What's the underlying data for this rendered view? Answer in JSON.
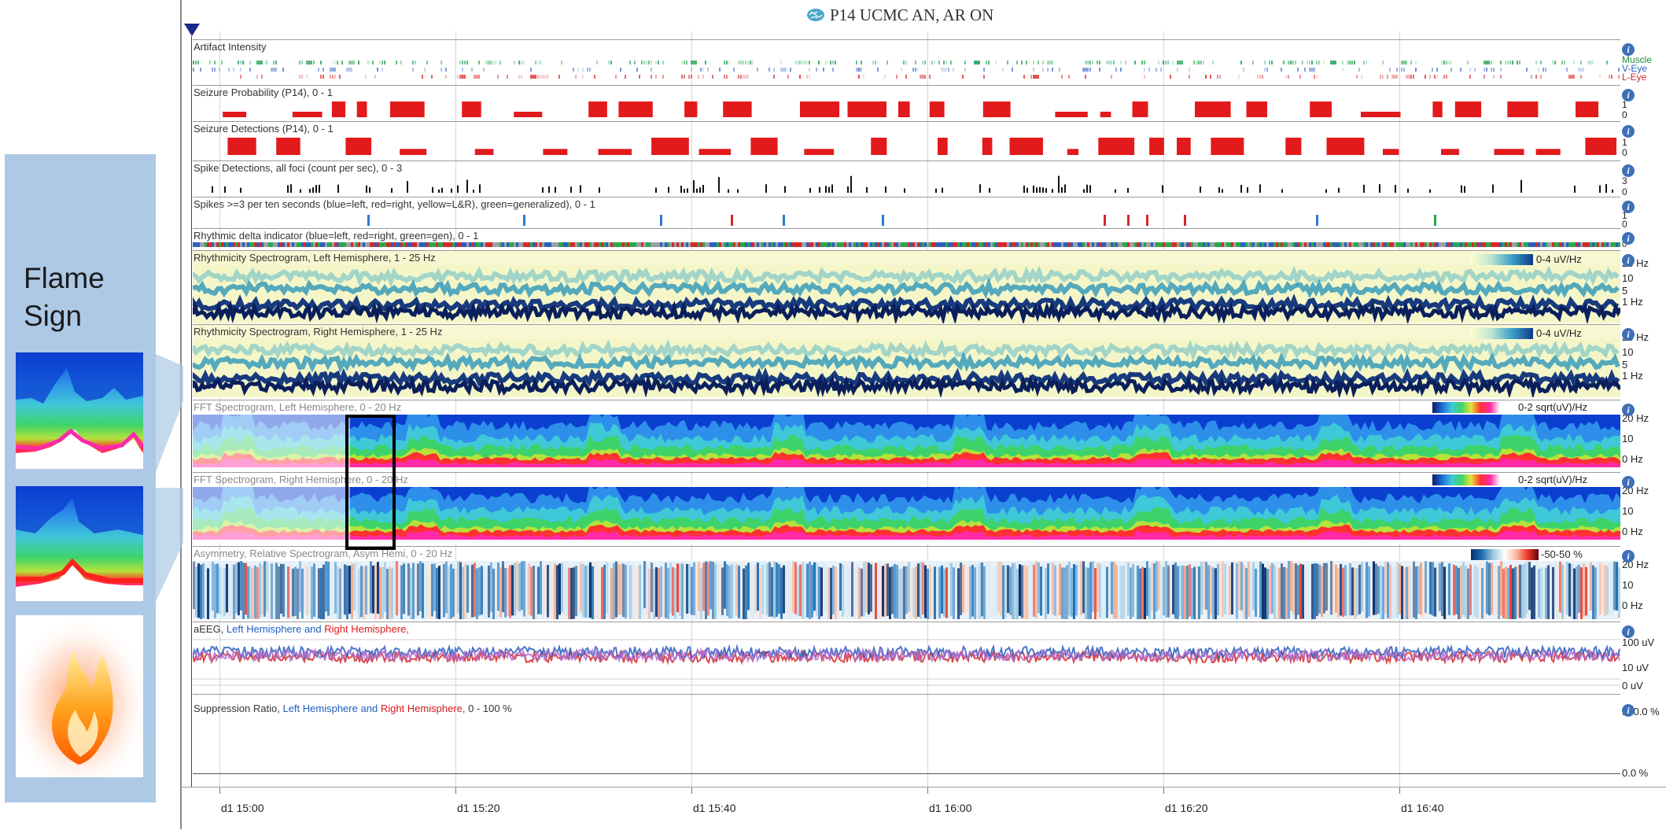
{
  "left_panel": {
    "title_line1": "Flame",
    "title_line2": "Sign",
    "thumbnails": [
      "fft-left-flame-thumbnail",
      "fft-right-flame-thumbnail",
      "flame-image"
    ],
    "color": "#adc9e6"
  },
  "window": {
    "title": "P14 UCMC AN, AR ON",
    "icon": "brain-icon"
  },
  "panels": {
    "artifact": {
      "label": "Artifact Intensity",
      "legend": [
        "Muscle",
        "V-Eye",
        "L-Eye"
      ],
      "legend_colors": [
        "#1a8f3c",
        "#2c5fbf",
        "#d62828"
      ]
    },
    "seizure_prob": {
      "label": "Seizure Probability (P14), 0 - 1",
      "ticks": [
        "1",
        "0"
      ],
      "color": "#e31a1c"
    },
    "seizure_det": {
      "label": "Seizure Detections (P14), 0 - 1",
      "ticks": [
        "1",
        "0"
      ],
      "color": "#e31a1c"
    },
    "spike_det": {
      "label": "Spike Detections, all foci (count per sec), 0 - 3",
      "ticks": [
        "3",
        "0"
      ]
    },
    "spikes_ten": {
      "label": "Spikes >=3 per ten seconds (blue=left, red=right, yellow=L&R), green=generalized),  0 - 1",
      "ticks": [
        "1",
        "0"
      ]
    },
    "rhythmic_delta": {
      "label": "Rhythmic delta indicator (blue=left, red=right, green=gen),  0 - 1",
      "ticks": [
        "1",
        "0"
      ]
    },
    "rhythm_left": {
      "label": "Rhythmicity Spectrogram, Left Hemisphere, 1 - 25 Hz",
      "scale_label": "0-4 uV/Hz",
      "ticks": [
        "25 Hz",
        "10",
        "5",
        "1 Hz"
      ]
    },
    "rhythm_right": {
      "label": "Rhythmicity Spectrogram, Right Hemisphere, 1 - 25 Hz",
      "scale_label": "0-4 uV/Hz",
      "ticks": [
        "25 Hz",
        "10",
        "5",
        "1 Hz"
      ]
    },
    "fft_left": {
      "label": "FFT Spectrogram, Left Hemisphere, 0 - 20 Hz",
      "scale_label": "0-2 sqrt(uV)/Hz",
      "ticks": [
        "20 Hz",
        "10",
        "0 Hz"
      ]
    },
    "fft_right": {
      "label": "FFT Spectrogram, Right Hemisphere, 0 - 20 Hz",
      "scale_label": "0-2 sqrt(uV)/Hz",
      "ticks": [
        "20 Hz",
        "10",
        "0 Hz"
      ]
    },
    "asym": {
      "label": "Asymmetry, Relative Spectrogram, Asym Hemi, 0 - 20 Hz",
      "scale_label": "-50-50 %",
      "ticks": [
        "20 Hz",
        "10",
        "0 Hz"
      ]
    },
    "aeeg": {
      "label_prefix": "aEEG,",
      "label_left": "Left Hemisphere",
      "label_and": "and",
      "label_right": "Right Hemisphere,",
      "ticks": [
        "100 uV",
        "10 uV",
        "0 uV"
      ]
    },
    "suppression": {
      "label_prefix": "Suppression Ratio,",
      "label_left": "Left Hemisphere",
      "label_and": "and",
      "label_right": "Right Hemisphere,",
      "label_range": "0 - 100 %",
      "ticks": [
        "100.0 %",
        "0.0 %"
      ]
    }
  },
  "time_axis": [
    "d1 15:00",
    "d1 15:20",
    "d1 15:40",
    "d1 16:00",
    "d1 16:20",
    "d1 16:40"
  ],
  "info_icon_glyph": "i",
  "colors": {
    "seizure_red": "#e31a1c",
    "left_blue": "#1f5fbf",
    "right_red": "#d7191c",
    "panel_bg": "#adc9e6"
  }
}
